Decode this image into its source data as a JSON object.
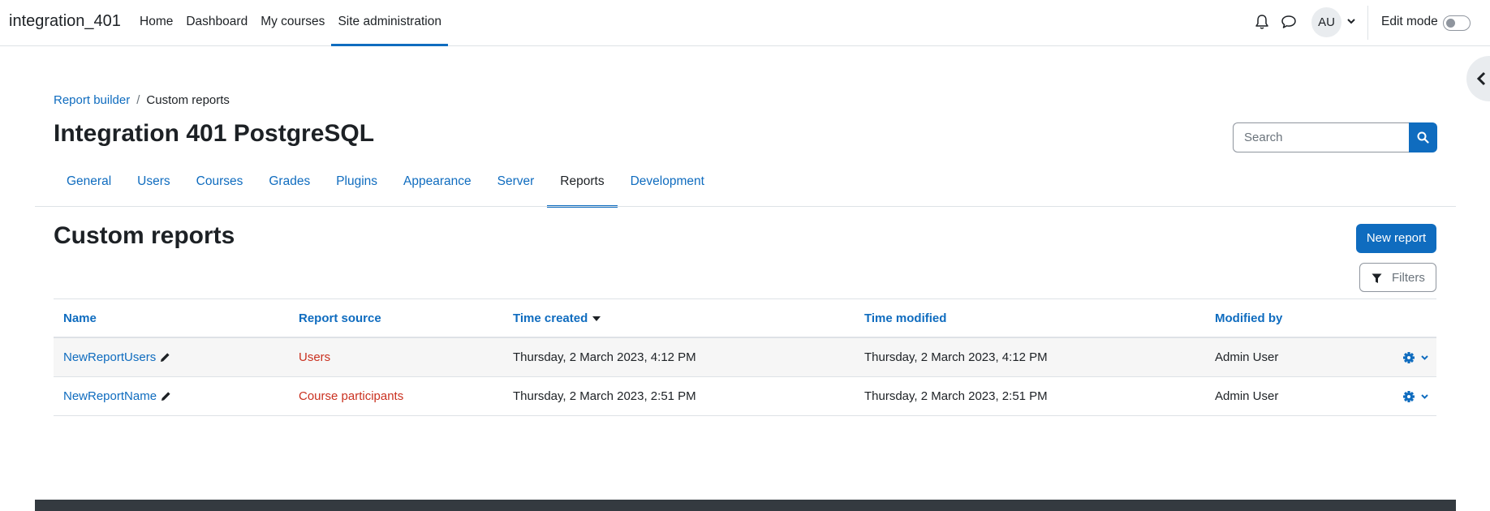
{
  "navbar": {
    "brand": "integration_401",
    "items": [
      {
        "label": "Home"
      },
      {
        "label": "Dashboard"
      },
      {
        "label": "My courses"
      },
      {
        "label": "Site administration"
      }
    ],
    "avatar_initials": "AU",
    "edit_mode_label": "Edit mode"
  },
  "breadcrumb": {
    "parent": "Report builder",
    "separator": "/",
    "current": "Custom reports"
  },
  "page_title": "Integration 401 PostgreSQL",
  "search": {
    "placeholder": "Search"
  },
  "tabs": [
    {
      "label": "General"
    },
    {
      "label": "Users"
    },
    {
      "label": "Courses"
    },
    {
      "label": "Grades"
    },
    {
      "label": "Plugins"
    },
    {
      "label": "Appearance"
    },
    {
      "label": "Server"
    },
    {
      "label": "Reports"
    },
    {
      "label": "Development"
    }
  ],
  "active_tab": "Reports",
  "section_title": "Custom reports",
  "buttons": {
    "new_report": "New report",
    "filters": "Filters"
  },
  "table": {
    "headers": {
      "name": "Name",
      "source": "Report source",
      "created": "Time created",
      "modified": "Time modified",
      "modified_by": "Modified by"
    },
    "rows": [
      {
        "name": "NewReportUsers",
        "source": "Users",
        "created": "Thursday, 2 March 2023, 4:12 PM",
        "modified": "Thursday, 2 March 2023, 4:12 PM",
        "modified_by": "Admin User"
      },
      {
        "name": "NewReportName",
        "source": "Course participants",
        "created": "Thursday, 2 March 2023, 2:51 PM",
        "modified": "Thursday, 2 March 2023, 2:51 PM",
        "modified_by": "Admin User"
      }
    ]
  },
  "colors": {
    "brand_blue": "#0f6cbf",
    "text": "#1d2125",
    "source_red": "#ca3120",
    "footer": "#343a40"
  },
  "icons": [
    "bell-icon",
    "chat-icon",
    "chevron-down-icon",
    "chevron-left-icon",
    "search-icon",
    "filter-icon",
    "pencil-icon",
    "gear-icon"
  ]
}
